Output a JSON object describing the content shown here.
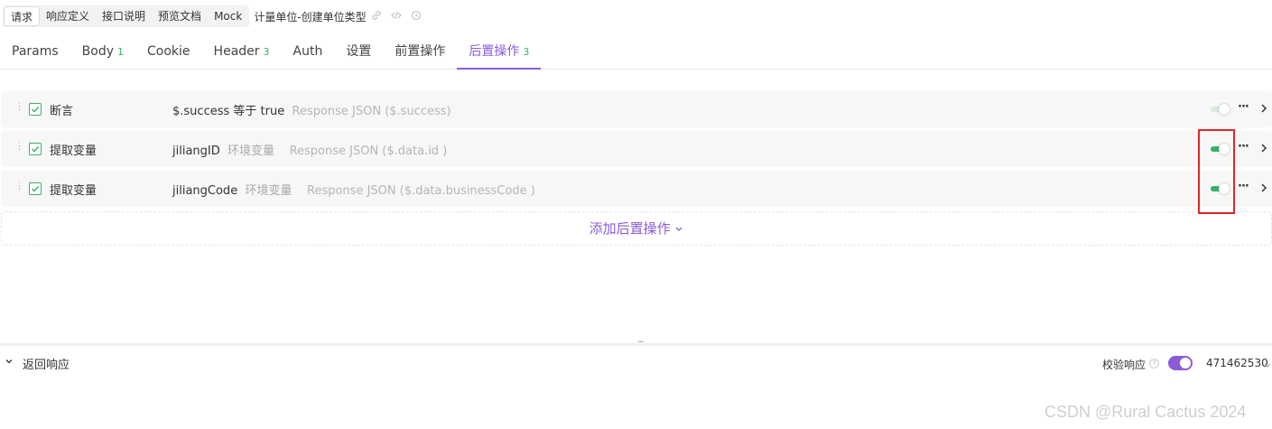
{
  "top_tabs": {
    "request": "请求",
    "response_def": "响应定义",
    "api_desc": "接口说明",
    "preview_doc": "预览文档",
    "mock": "Mock"
  },
  "api_title": "计量单位-创建单位类型",
  "sub_tabs": [
    {
      "label": "Params",
      "count": ""
    },
    {
      "label": "Body",
      "count": "1"
    },
    {
      "label": "Cookie",
      "count": ""
    },
    {
      "label": "Header",
      "count": "3"
    },
    {
      "label": "Auth",
      "count": ""
    },
    {
      "label": "设置",
      "count": ""
    },
    {
      "label": "前置操作",
      "count": ""
    },
    {
      "label": "后置操作",
      "count": "3"
    }
  ],
  "active_sub_tab": "后置操作",
  "operations": [
    {
      "type": "断言",
      "main": "$.success 等于 true",
      "scope": "",
      "source": "Response JSON ($.success)",
      "enabled": false
    },
    {
      "type": "提取变量",
      "main": "jiliangID",
      "scope": "环境变量",
      "source": "Response JSON ($.data.id )",
      "enabled": true
    },
    {
      "type": "提取变量",
      "main": "jiliangCode",
      "scope": "环境变量",
      "source": "Response JSON ($.data.businessCode )",
      "enabled": true
    }
  ],
  "add_operation_label": "添加后置操作",
  "bottom": {
    "response_label": "返回响应",
    "verify_label": "校验响应",
    "verify_enabled": true,
    "env_id": "471462530"
  },
  "watermark": "CSDN @Rural Cactus 2024",
  "colors": {
    "accent": "#8a5cd8",
    "green": "#3db06b",
    "highlight": "#e0262b"
  }
}
